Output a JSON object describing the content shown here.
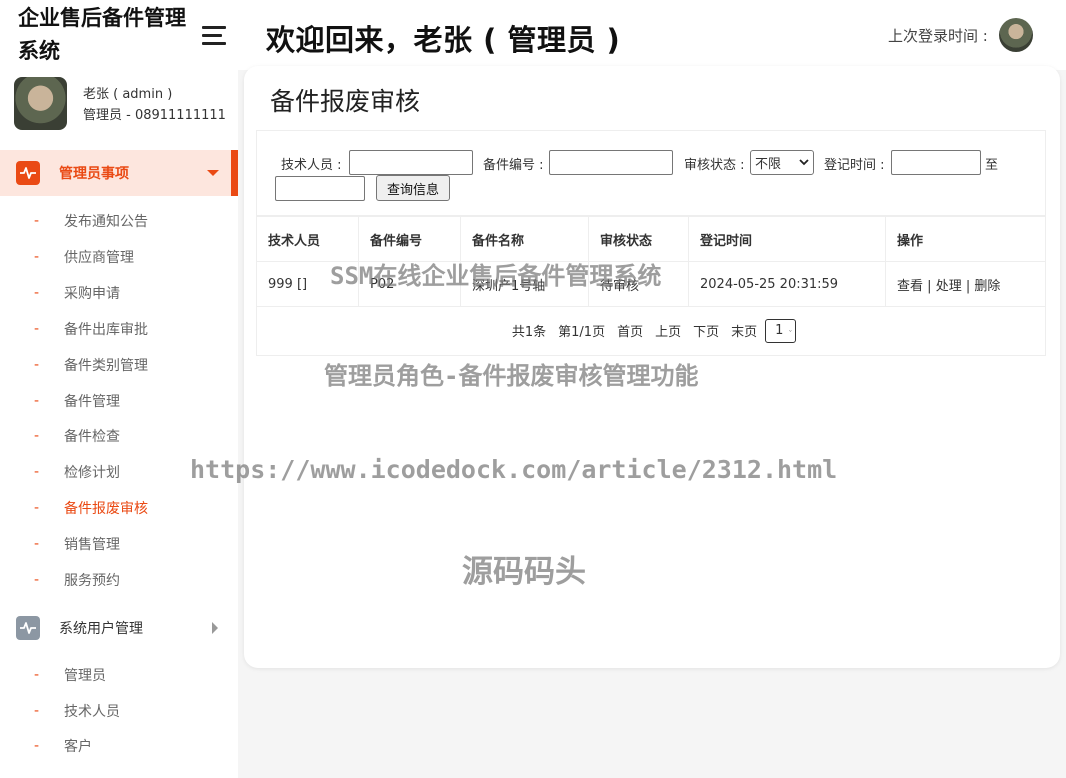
{
  "app": {
    "brand_line1": "企业售后备件管理",
    "brand_line2": "系统"
  },
  "user": {
    "name": "老张 ( admin )",
    "role": "管理员 - 08911111111"
  },
  "header": {
    "welcome": "欢迎回来，老张 ( 管理员 )",
    "last_login_label": "上次登录时间 :"
  },
  "sidebar": {
    "group1": {
      "label": "管理员事项",
      "items": [
        {
          "label": "发布通知公告"
        },
        {
          "label": "供应商管理"
        },
        {
          "label": "采购申请"
        },
        {
          "label": "备件出库审批"
        },
        {
          "label": "备件类别管理"
        },
        {
          "label": "备件管理"
        },
        {
          "label": "备件检查"
        },
        {
          "label": "检修计划"
        },
        {
          "label": "备件报废审核"
        },
        {
          "label": "销售管理"
        },
        {
          "label": "服务预约"
        }
      ],
      "current": "备件报废审核"
    },
    "group2": {
      "label": "系统用户管理",
      "items": [
        {
          "label": "管理员"
        },
        {
          "label": "技术人员"
        },
        {
          "label": "客户"
        }
      ]
    },
    "dash": "-"
  },
  "main": {
    "title": "备件报废审核",
    "filters": {
      "tech_label": "技术人员 :",
      "tech_value": "",
      "code_label": "备件编号 :",
      "code_value": "",
      "status_label": "审核状态 :",
      "status_value": "不限",
      "date_label": "登记时间 :",
      "date_from": "",
      "to_label": "至",
      "date_to": "",
      "query_button": "查询信息"
    },
    "table": {
      "headers": [
        "技术人员",
        "备件编号",
        "备件名称",
        "审核状态",
        "登记时间",
        "操作"
      ],
      "rows": [
        {
          "tech": "999 []",
          "code": "P02",
          "name": "深圳产1号轴",
          "status": "待审核",
          "time": "2024-05-25 20:31:59",
          "op_view": "查看",
          "op_handle": "处理",
          "op_delete": "删除",
          "sep": "|"
        }
      ]
    },
    "pager": {
      "total": "共1条",
      "page_info": "第1/1页",
      "first": "首页",
      "prev": "上页",
      "next": "下页",
      "last": "末页",
      "current": "1"
    }
  },
  "watermarks": {
    "line1": "SSM在线企业售后备件管理系统",
    "line2": "管理员角色-备件报废审核管理功能",
    "line3": "https://www.icodedock.com/article/2312.html",
    "line4": "源码码头"
  },
  "colors": {
    "accent": "#ea4a14",
    "active_bg": "#fde6de",
    "inactive_icon": "#8c97a3"
  },
  "icons": {
    "menu_toggle": "hamburger-icon",
    "group1_icon": "activity-wave-icon",
    "group2_icon": "activity-wave-icon",
    "expand": "caret-down-icon",
    "collapse": "caret-right-icon"
  }
}
